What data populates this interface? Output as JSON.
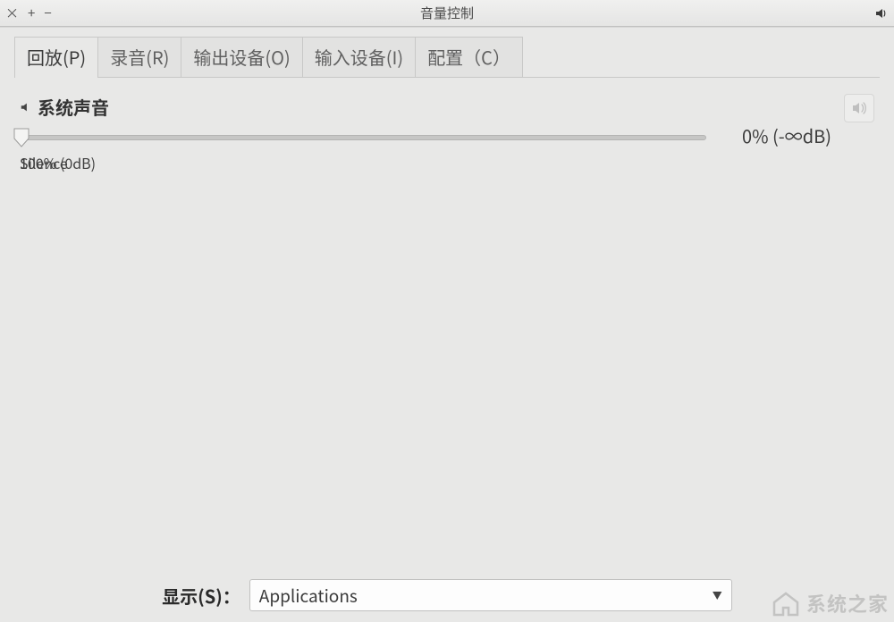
{
  "window": {
    "title": "音量控制",
    "controls": {
      "close": "×",
      "plus": "+",
      "minus": "−"
    }
  },
  "tabs": [
    {
      "label": "回放(P)",
      "active": true
    },
    {
      "label": "录音(R)",
      "active": false
    },
    {
      "label": "输出设备(O)",
      "active": false
    },
    {
      "label": "输入设备(I)",
      "active": false
    },
    {
      "label": "配置（C）",
      "active": false
    }
  ],
  "stream": {
    "name": "系统声音",
    "slider": {
      "min_label": "Silence",
      "mid_label": "100% (0dB)",
      "value_pct": 0
    },
    "readout": "0% (-∞dB)"
  },
  "footer": {
    "label": "显示(S)：",
    "selected": "Applications"
  },
  "watermark": "系统之家"
}
